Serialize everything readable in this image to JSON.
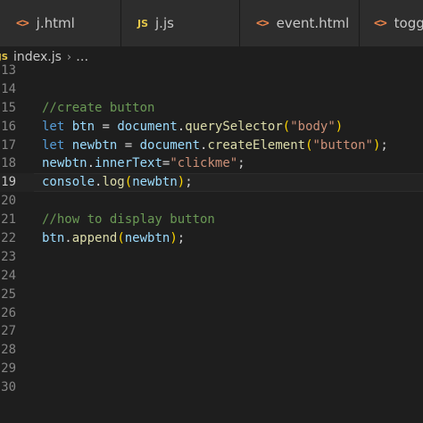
{
  "tabs": [
    {
      "label": "j.html",
      "icon": "html-file-icon"
    },
    {
      "label": "j.js",
      "icon": "js-file-icon"
    },
    {
      "label": "event.html",
      "icon": "html-file-icon"
    },
    {
      "label": "toggle",
      "icon": "html-file-icon"
    }
  ],
  "icons": {
    "html_glyph": "<>",
    "js_glyph": "JS"
  },
  "breadcrumb": {
    "file": "index.js",
    "separator": "›",
    "rest": "…"
  },
  "current_line": "19",
  "lines": [
    {
      "num": "13",
      "tokens": []
    },
    {
      "num": "14",
      "tokens": []
    },
    {
      "num": "15",
      "tokens": [
        {
          "t": "cm",
          "v": "//create button"
        }
      ]
    },
    {
      "num": "16",
      "tokens": [
        {
          "t": "kw",
          "v": "let"
        },
        {
          "t": "pn",
          "v": " "
        },
        {
          "t": "var",
          "v": "btn"
        },
        {
          "t": "pn",
          "v": " = "
        },
        {
          "t": "var",
          "v": "document"
        },
        {
          "t": "pn",
          "v": "."
        },
        {
          "t": "fn",
          "v": "querySelector"
        },
        {
          "t": "br",
          "v": "("
        },
        {
          "t": "str",
          "v": "\"body\""
        },
        {
          "t": "br",
          "v": ")"
        }
      ]
    },
    {
      "num": "17",
      "tokens": [
        {
          "t": "kw",
          "v": "let"
        },
        {
          "t": "pn",
          "v": " "
        },
        {
          "t": "var",
          "v": "newbtn"
        },
        {
          "t": "pn",
          "v": " = "
        },
        {
          "t": "var",
          "v": "document"
        },
        {
          "t": "pn",
          "v": "."
        },
        {
          "t": "fn",
          "v": "createElement"
        },
        {
          "t": "br",
          "v": "("
        },
        {
          "t": "str",
          "v": "\"button\""
        },
        {
          "t": "br",
          "v": ")"
        },
        {
          "t": "pn",
          "v": ";"
        }
      ]
    },
    {
      "num": "18",
      "tokens": [
        {
          "t": "var",
          "v": "newbtn"
        },
        {
          "t": "pn",
          "v": "."
        },
        {
          "t": "var",
          "v": "innerText"
        },
        {
          "t": "pn",
          "v": "="
        },
        {
          "t": "str",
          "v": "\"clickme\""
        },
        {
          "t": "pn",
          "v": ";"
        }
      ]
    },
    {
      "num": "19",
      "tokens": [
        {
          "t": "var",
          "v": "console"
        },
        {
          "t": "pn",
          "v": "."
        },
        {
          "t": "fn",
          "v": "log"
        },
        {
          "t": "br",
          "v": "("
        },
        {
          "t": "var",
          "v": "newbtn"
        },
        {
          "t": "br",
          "v": ")"
        },
        {
          "t": "pn",
          "v": ";"
        }
      ]
    },
    {
      "num": "20",
      "tokens": []
    },
    {
      "num": "21",
      "tokens": [
        {
          "t": "cm",
          "v": "//how to display button"
        }
      ]
    },
    {
      "num": "22",
      "tokens": [
        {
          "t": "var",
          "v": "btn"
        },
        {
          "t": "pn",
          "v": "."
        },
        {
          "t": "fn",
          "v": "append"
        },
        {
          "t": "br",
          "v": "("
        },
        {
          "t": "var",
          "v": "newbtn"
        },
        {
          "t": "br",
          "v": ")"
        },
        {
          "t": "pn",
          "v": ";"
        }
      ]
    },
    {
      "num": "23",
      "tokens": []
    },
    {
      "num": "24",
      "tokens": []
    },
    {
      "num": "25",
      "tokens": []
    },
    {
      "num": "26",
      "tokens": []
    },
    {
      "num": "27",
      "tokens": []
    },
    {
      "num": "28",
      "tokens": []
    },
    {
      "num": "29",
      "tokens": []
    },
    {
      "num": "30",
      "tokens": []
    }
  ],
  "colors": {
    "keyword": "#569cd6",
    "variable": "#9cdcfe",
    "function": "#dcdcaa",
    "string": "#ce9178",
    "comment": "#6a9955",
    "bracket": "#ffd700"
  }
}
